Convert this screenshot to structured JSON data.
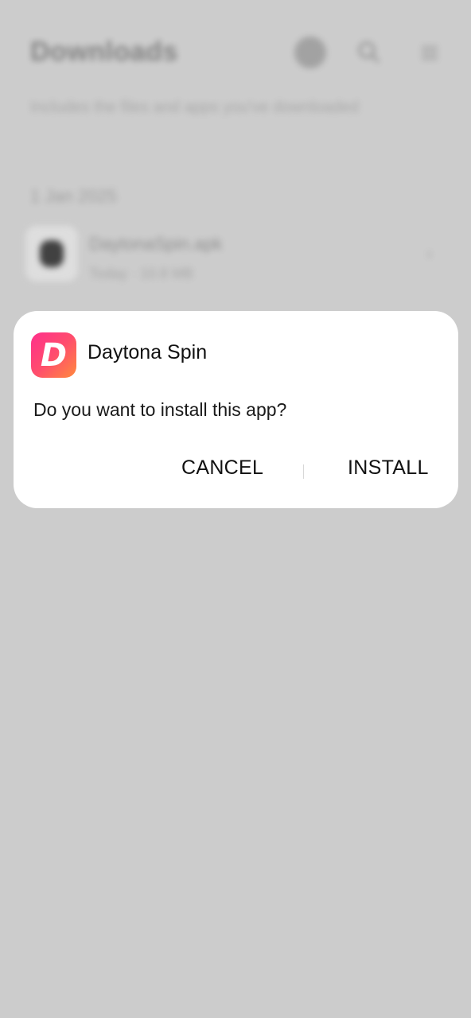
{
  "background": {
    "title": "Downloads",
    "subtitle": "Includes the files and apps you've downloaded",
    "date_header": "1 Jan 2025",
    "file": {
      "name": "DaytonaSpin.apk",
      "meta": "Today · 10.8 MB",
      "more_icon": "chevron-right-icon"
    },
    "icons": [
      "circle-icon",
      "search-icon",
      "more-vert-icon"
    ]
  },
  "dialog": {
    "app_name": "Daytona Spin",
    "app_icon_letter": "D",
    "message": "Do you want to install this app?",
    "cancel_label": "CANCEL",
    "install_label": "INSTALL"
  },
  "colors": {
    "scrim": "#cccccc",
    "dialog_bg": "#ffffff",
    "icon_gradient": [
      "#ff2f8c",
      "#ff8a3d"
    ]
  }
}
